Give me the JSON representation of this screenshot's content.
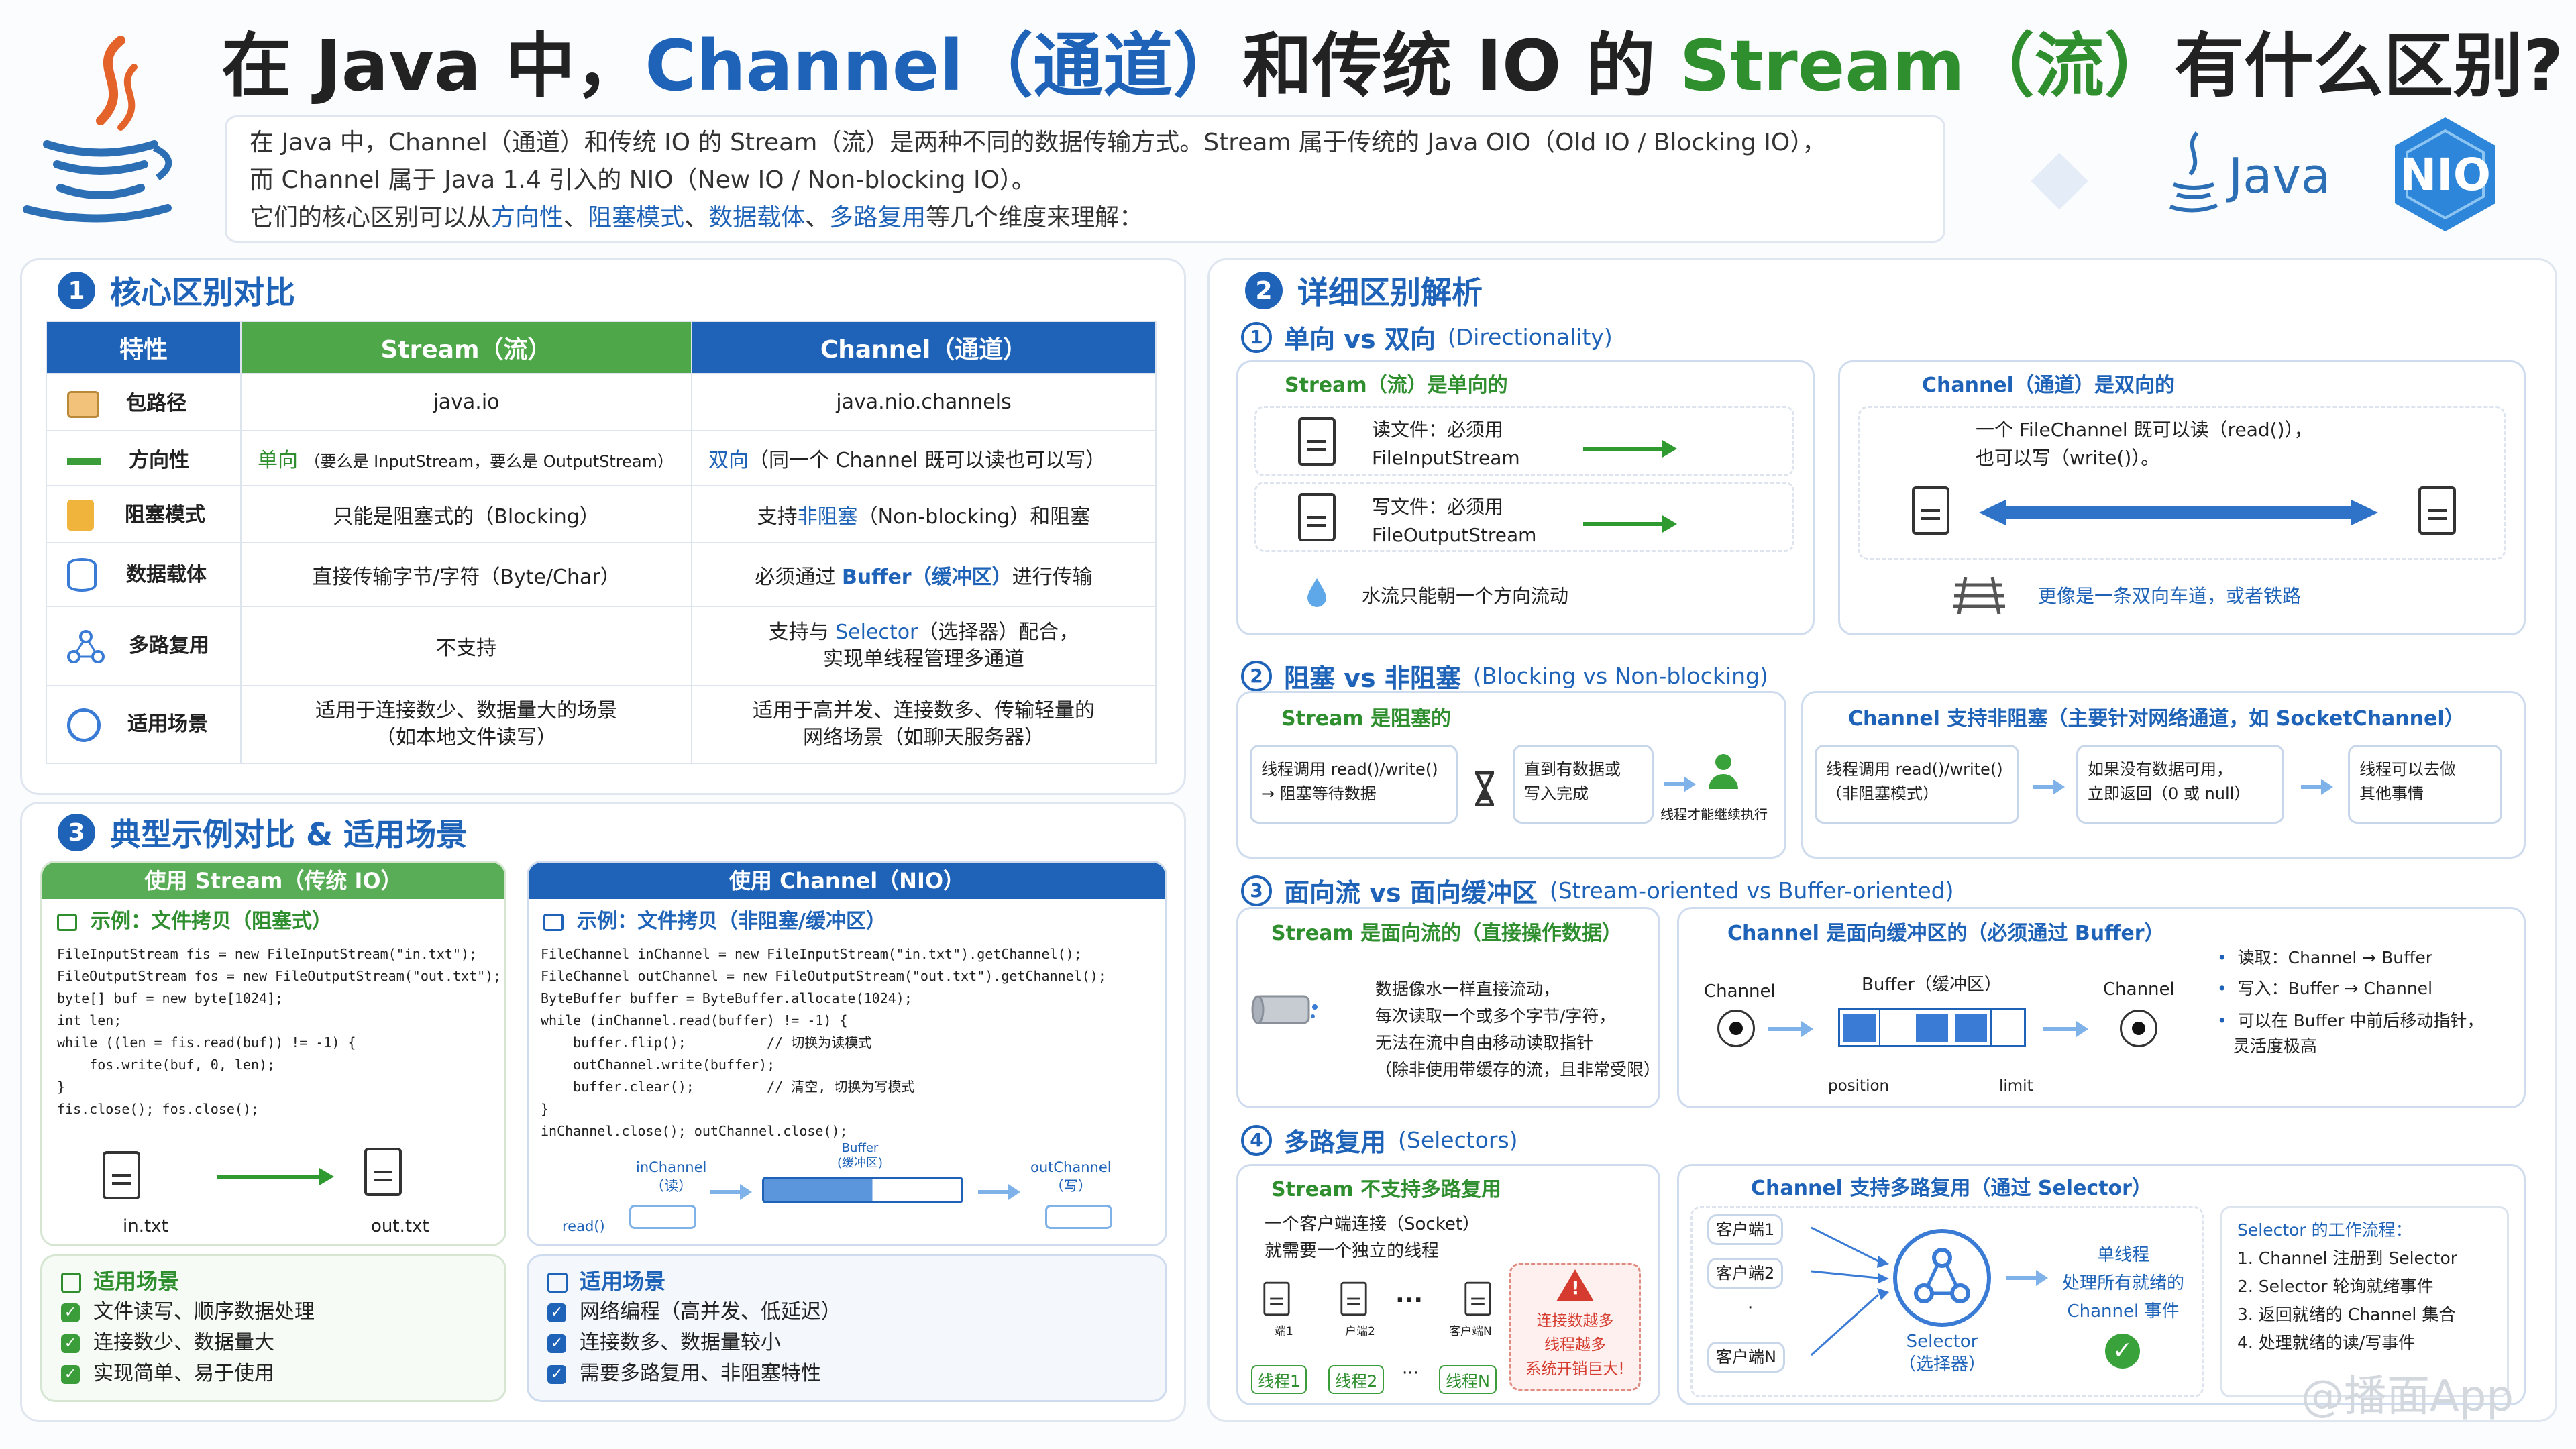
{
  "header": {
    "title_a": "在 Java 中，",
    "title_channel": "Channel（通道）",
    "title_b": "和传统 IO 的 ",
    "title_stream": "Stream（流）",
    "title_c": "有什么区别?",
    "intro_line1": "在 Java 中，Channel（通道）和传统 IO 的 Stream（流）是两种不同的数据传输方式。Stream 属于传统的 Java OIO（Old IO / Blocking IO），",
    "intro_line2": "而 Channel 属于 Java 1.4 引入的 NIO（New IO / Non-blocking IO）。",
    "intro_line3_a": "它们的核心区别可以从",
    "intro_kw1": "方向性",
    "intro_kw2": "阻塞模式",
    "intro_kw3": "数据载体",
    "intro_kw4": "多路复用",
    "intro_line3_b": "等几个维度来理解：",
    "java_logo": "Java",
    "nio_logo": "NIO"
  },
  "sec1": {
    "num": "1",
    "title": "核心区别对比",
    "th_feature": "特性",
    "th_stream": "Stream（流）",
    "th_channel": "Channel（通道）",
    "rows": [
      {
        "label": "包路径",
        "stream": "java.io",
        "channel": "java.nio.channels"
      },
      {
        "label": "方向性",
        "stream_kw": "单向",
        "stream": "（要么是 InputStream，要么是 OutputStream）",
        "channel_kw": "双向",
        "channel": "（同一个 Channel 既可以读也可以写）"
      },
      {
        "label": "阻塞模式",
        "stream": "只能是阻塞式的（Blocking）",
        "channel_a": "支持",
        "channel_kw": "非阻塞",
        "channel_b": "（Non-blocking）和阻塞"
      },
      {
        "label": "数据载体",
        "stream": "直接传输字节/字符（Byte/Char）",
        "channel_a": "必须通过 ",
        "channel_kw": "Buffer（缓冲区）",
        "channel_b": "进行传输"
      },
      {
        "label": "多路复用",
        "stream": "不支持",
        "channel_a": "支持与 ",
        "channel_kw": "Selector",
        "channel_b": "（选择器）配合，",
        "channel_c": "实现单线程管理多通道"
      },
      {
        "label": "适用场景",
        "stream": "适用于连接数少、数据量大的场景",
        "stream2": "（如本地文件读写）",
        "channel": "适用于高并发、连接数多、传输轻量的",
        "channel2": "网络场景（如聊天服务器）"
      }
    ]
  },
  "sec3": {
    "num": "3",
    "title": "典型示例对比 & 适用场景",
    "left_header": "使用 Stream（传统 IO）",
    "left_example": "示例：文件拷贝（阻塞式）",
    "left_code": [
      "FileInputStream fis = new FileInputStream(\"in.txt\");",
      "FileOutputStream fos = new FileOutputStream(\"out.txt\");",
      "byte[] buf = new byte[1024];",
      "int len;",
      "while ((len = fis.read(buf)) != -1) {",
      "    fos.write(buf, 0, len);",
      "}",
      "fis.close(); fos.close();"
    ],
    "left_in": "in.txt",
    "left_out": "out.txt",
    "right_header": "使用 Channel（NIO）",
    "right_example": "示例：文件拷贝（非阻塞/缓冲区）",
    "right_code": [
      "FileChannel inChannel = new FileInputStream(\"in.txt\").getChannel();",
      "FileChannel outChannel = new FileOutputStream(\"out.txt\").getChannel();",
      "ByteBuffer buffer = ByteBuffer.allocate(1024);",
      "while (inChannel.read(buffer) != -1) {",
      "    buffer.flip();          // 切换为读模式",
      "    outChannel.write(buffer);",
      "    buffer.clear();         // 清空, 切换为写模式",
      "}",
      "inChannel.close(); outChannel.close();"
    ],
    "right_inchannel": "inChannel",
    "right_in_read": "（读）",
    "right_buffer": "Buffer",
    "right_buffer2": "(缓冲区)",
    "right_outchannel": "outChannel",
    "right_out_write": "（写）",
    "right_read": "read()",
    "left_scenes_title": "适用场景",
    "left_scenes": [
      "文件读写、顺序数据处理",
      "连接数少、数据量大",
      "实现简单、易于使用"
    ],
    "right_scenes_title": "适用场景",
    "right_scenes": [
      "网络编程（高并发、低延迟）",
      "连接数多、数据量较小",
      "需要多路复用、非阻塞特性"
    ]
  },
  "sec2": {
    "num": "2",
    "title": "详细区别解析",
    "s1": {
      "num": "1",
      "title": "单向 vs 双向",
      "title_en": "(Directionality)",
      "stream_head": "Stream（流）是单向的",
      "read_line1": "读文件：必须用",
      "read_line2": "FileInputStream",
      "write_line1": "写文件：必须用",
      "write_line2": "FileOutputStream",
      "water": "水流只能朝一个方向流动",
      "channel_head": "Channel（通道）是双向的",
      "bi_line1": "一个 FileChannel 既可以读（read()），",
      "bi_line2": "也可以写（write()）。",
      "rail": "更像是一条双向车道，或者铁路"
    },
    "s2": {
      "num": "2",
      "title": "阻塞 vs 非阻塞",
      "title_en": "(Blocking vs Non-blocking)",
      "stream_head": "Stream 是阻塞的",
      "b1_line1": "线程调用 read()/write()",
      "b1_line2": "→ 阻塞等待数据",
      "b2_line1": "直到有数据或",
      "b2_line2": "写入完成",
      "b3": "线程才能继续执行",
      "channel_head": "Channel 支持非阻塞（主要针对网络通道，如 SocketChannel）",
      "n1_line1": "线程调用 read()/write()",
      "n1_line2": "（非阻塞模式）",
      "n2_line1": "如果没有数据可用，",
      "n2_line2": "立即返回（0 或 null）",
      "n3_line1": "线程可以去做",
      "n3_line2": "其他事情"
    },
    "s3": {
      "num": "3",
      "title": "面向流 vs 面向缓冲区",
      "title_en": "(Stream-oriented vs Buffer-oriented)",
      "stream_head": "Stream 是面向流的（直接操作数据）",
      "desc1": "数据像水一样直接流动，",
      "desc2": "每次读取一个或多个字节/字符，",
      "desc3": "无法在流中自由移动读取指针",
      "desc4": "（除非使用带缓存的流，且非常受限）",
      "channel_head": "Channel 是面向缓冲区的（必须通过 Buffer）",
      "ch_left": "Channel",
      "buffer_label": "Buffer（缓冲区）",
      "ch_right": "Channel",
      "position": "position",
      "limit": "limit",
      "bullet1": "读取：Channel → Buffer",
      "bullet2": "写入：Buffer → Channel",
      "bullet3a": "可以在 Buffer 中前后移动指针，",
      "bullet3b": "灵活度极高"
    },
    "s4": {
      "num": "4",
      "title": "多路复用",
      "title_en": "(Selectors)",
      "stream_head": "Stream 不支持多路复用",
      "desc1": "一个客户端连接（Socket）",
      "desc2": "就需要一个独立的线程",
      "cli1": "端1",
      "cli2": "户端2",
      "clin": "客户端N",
      "th1": "线程1",
      "th2": "线程2",
      "thn": "线程N",
      "dots": "···",
      "warn1": "连接数越多",
      "warn2": "线程越多",
      "warn3": "系统开销巨大!",
      "channel_head": "Channel 支持多路复用（通过 Selector）",
      "c1": "客户端1",
      "c2": "客户端2",
      "cn": "客户端N",
      "selector": "Selector",
      "selector2": "（选择器）",
      "single1": "单线程",
      "single2": "处理所有就绪的",
      "single3": "Channel 事件",
      "flow_title": "Selector 的工作流程：",
      "flow": [
        "1. Channel 注册到 Selector",
        "2. Selector 轮询就绪事件",
        "3. 返回就绪的 Channel 集合",
        "4. 处理就绪的读/写事件"
      ]
    }
  },
  "watermark": "@播面App",
  "colors": {
    "blue": "#1e63b8",
    "green": "#2f8f2f",
    "red": "#d63b2f"
  }
}
